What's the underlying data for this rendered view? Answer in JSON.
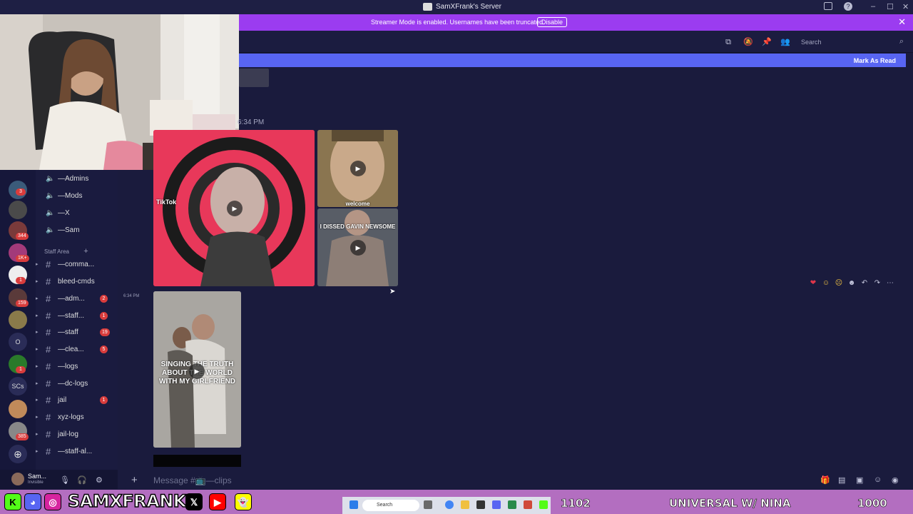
{
  "window": {
    "title": "SamXFrank's Server"
  },
  "banner": {
    "message": "Streamer Mode is enabled. Usernames have been truncated.",
    "disable_label": "Disable"
  },
  "header": {
    "search_placeholder": "Search"
  },
  "mark_read": {
    "label": "Mark As Read"
  },
  "messages": {
    "timestamp_top": "6:34 PM",
    "timestamp_second": "6:34 PM",
    "media": [
      {
        "label": "TikTok"
      },
      {
        "caption": "welcome"
      },
      {
        "caption": "I DISSED GAVIN NEWSOME"
      },
      {
        "caption": "SINGING THE TRUTH ABOUT THE WORLD WITH MY GIRLFRIEND"
      }
    ]
  },
  "channels": {
    "voice": [
      {
        "name": "—Admins"
      },
      {
        "name": "—Mods"
      },
      {
        "name": "—X"
      },
      {
        "name": "—Sam"
      }
    ],
    "category": "Staff Area",
    "text": [
      {
        "name": "—comma...",
        "badge": ""
      },
      {
        "name": "bleed-cmds",
        "badge": ""
      },
      {
        "name": "—adm...",
        "badge": "2"
      },
      {
        "name": "—staff...",
        "badge": "1"
      },
      {
        "name": "—staff",
        "badge": "19"
      },
      {
        "name": "—clea...",
        "badge": "5"
      },
      {
        "name": "—logs",
        "badge": ""
      },
      {
        "name": "—dc-logs",
        "badge": ""
      },
      {
        "name": "jail",
        "badge": "1"
      },
      {
        "name": "xyz-logs",
        "badge": ""
      },
      {
        "name": "jail-log",
        "badge": ""
      },
      {
        "name": "—staff-al...",
        "badge": ""
      }
    ]
  },
  "servers": {
    "badges": [
      "3",
      "344",
      "1K+",
      "1",
      "159",
      "1",
      "385"
    ],
    "text_icons": [
      "O",
      "SCs"
    ]
  },
  "user": {
    "name": "Sam...",
    "status": "Invisible"
  },
  "composer": {
    "placeholder": "Message #📺—clips"
  },
  "overlay": {
    "brand": "SAMXFRANK",
    "stat_left": "1102",
    "stat_center": "UNIVERSAL W/ NINA",
    "stat_right": "1000",
    "taskbar_search": "Search"
  }
}
